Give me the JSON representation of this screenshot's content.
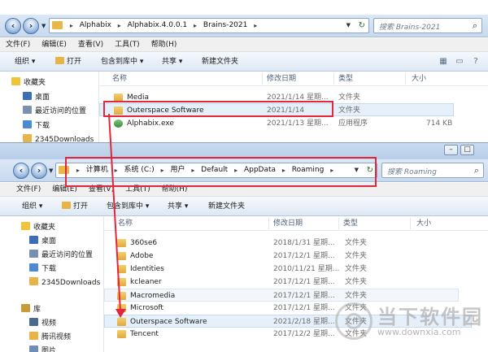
{
  "window1": {
    "breadcrumbs": [
      "Alphabix",
      "Alphabix.4.0.0.1",
      "Brains-2021"
    ],
    "search_placeholder": "搜索 Brains-2021",
    "menu": [
      "文件(F)",
      "编辑(E)",
      "查看(V)",
      "工具(T)",
      "帮助(H)"
    ],
    "toolbar": {
      "organize": "组织 ▾",
      "open": "打开",
      "include": "包含到库中 ▾",
      "share": "共享 ▾",
      "new_folder": "新建文件夹"
    },
    "nav": [
      {
        "label": "收藏夹",
        "icon": "star-icon"
      },
      {
        "label": "桌面",
        "icon": "desktop-icon"
      },
      {
        "label": "最近访问的位置",
        "icon": "recent-places-icon"
      },
      {
        "label": "下载",
        "icon": "downloads-icon"
      },
      {
        "label": "2345Downloads",
        "icon": "folder-icon"
      }
    ],
    "columns": {
      "name": "名称",
      "date": "修改日期",
      "type": "类型",
      "size": "大小"
    },
    "files": [
      {
        "name": "Media",
        "date": "2021/1/14 星期...",
        "type": "文件夹",
        "size": ""
      },
      {
        "name": "Outerspace Software",
        "date": "2021/1/14",
        "type": "文件夹",
        "size": ""
      },
      {
        "name": "Alphabix.exe",
        "date": "2021/1/13 星期...",
        "type": "应用程序",
        "size": "714 KB"
      }
    ]
  },
  "window2": {
    "breadcrumbs": [
      "计算机",
      "系统 (C:)",
      "用户",
      "Default",
      "AppData",
      "Roaming"
    ],
    "search_placeholder": "搜索 Roaming",
    "menu": [
      "文件(F)",
      "编辑(E)",
      "查看(V)",
      "工具(T)",
      "帮助(H)"
    ],
    "toolbar": {
      "organize": "组织 ▾",
      "open": "打开",
      "include": "包含到库中 ▾",
      "share": "共享 ▾",
      "new_folder": "新建文件夹"
    },
    "nav": [
      {
        "label": "收藏夹",
        "icon": "star-icon"
      },
      {
        "label": "桌面",
        "icon": "desktop-icon"
      },
      {
        "label": "最近访问的位置",
        "icon": "recent-places-icon"
      },
      {
        "label": "下载",
        "icon": "downloads-icon"
      },
      {
        "label": "2345Downloads",
        "icon": "folder-icon"
      },
      {
        "label": "库",
        "icon": "library-icon"
      },
      {
        "label": "视频",
        "icon": "video-icon"
      },
      {
        "label": "腾讯视频",
        "icon": "tencent-video-icon"
      },
      {
        "label": "图片",
        "icon": "pictures-icon"
      }
    ],
    "columns": {
      "name": "名称",
      "date": "修改日期",
      "type": "类型",
      "size": "大小"
    },
    "files": [
      {
        "name": "360se6",
        "date": "2018/1/31 星期...",
        "type": "文件夹"
      },
      {
        "name": "Adobe",
        "date": "2017/12/1 星期...",
        "type": "文件夹"
      },
      {
        "name": "Identities",
        "date": "2010/11/21 星期...",
        "type": "文件夹"
      },
      {
        "name": "kcleaner",
        "date": "2017/12/1 星期...",
        "type": "文件夹"
      },
      {
        "name": "Macromedia",
        "date": "2017/12/1 星期...",
        "type": "文件夹"
      },
      {
        "name": "Microsoft",
        "date": "2017/12/1 星期...",
        "type": "文件夹"
      },
      {
        "name": "Outerspace Software",
        "date": "2021/2/18 星期...",
        "type": "文件夹"
      },
      {
        "name": "Tencent",
        "date": "2017/12/2 星期...",
        "type": "文件夹"
      }
    ]
  },
  "watermark": {
    "brand": "当下软件园",
    "url": "www.downxia.com"
  },
  "colors": {
    "highlight": "#e3263a",
    "folder": "#e7b44a",
    "selection": "#e5f0fb"
  }
}
